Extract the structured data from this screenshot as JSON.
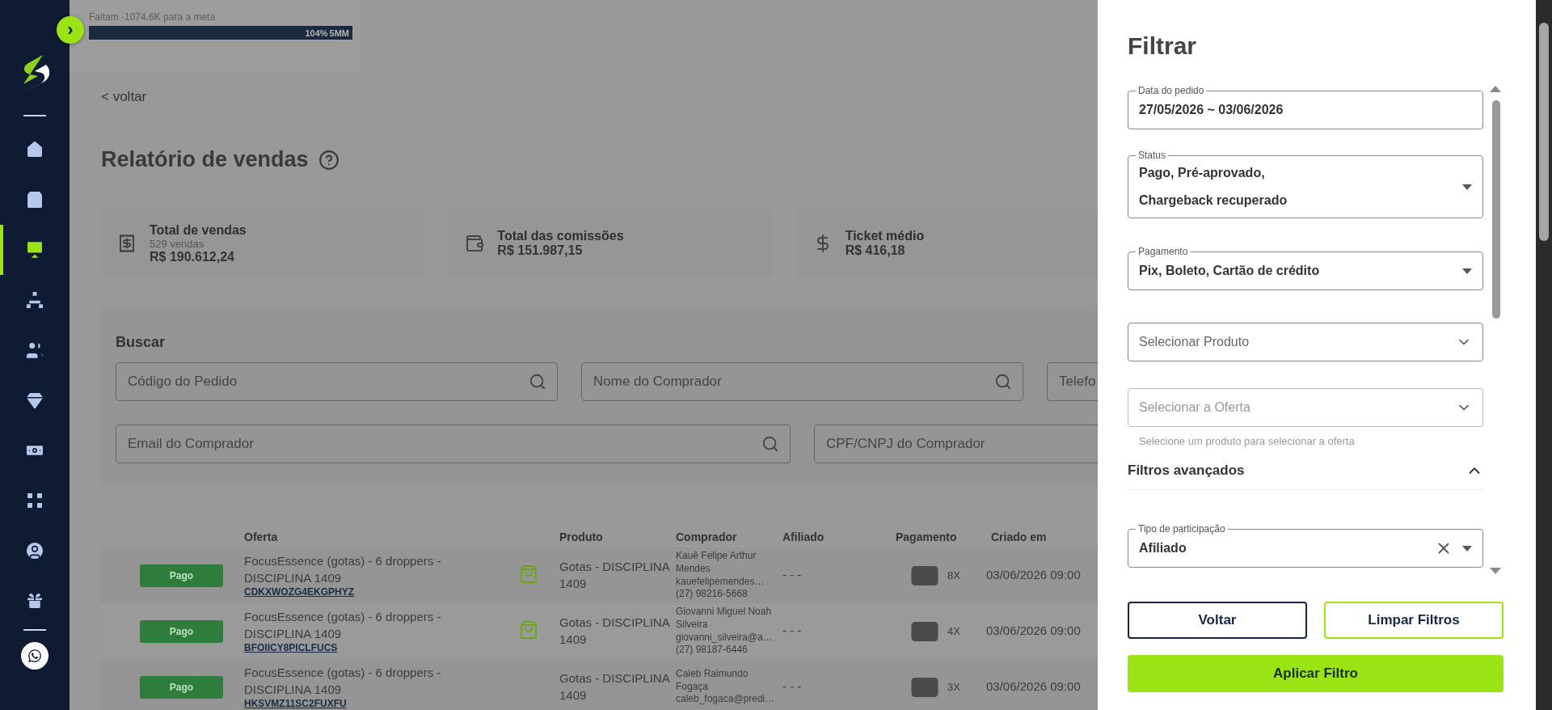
{
  "sidebar": {
    "toggle": "›",
    "items": [
      {
        "selected": false
      },
      {
        "selected": false
      },
      {
        "selected": true
      },
      {
        "selected": false
      },
      {
        "selected": false
      },
      {
        "selected": false
      },
      {
        "selected": false
      },
      {
        "selected": false
      },
      {
        "selected": false
      },
      {
        "selected": false
      }
    ]
  },
  "goal": {
    "caption": "Faltam -1074.6K para a meta",
    "level": 1,
    "percent": "104%",
    "target": "5MM"
  },
  "back_link": "< voltar",
  "title": "Relatório de vendas",
  "summary": [
    {
      "label": "Total de vendas",
      "sub": "529 vendas",
      "value": "R$ 190.612,24"
    },
    {
      "label": "Total das comissões",
      "value": "R$ 151.987,15"
    },
    {
      "label": "Ticket médio",
      "value": "R$ 416,18"
    }
  ],
  "search": {
    "title": "Buscar",
    "rows": [
      [
        {
          "placeholder": "Código do Pedido"
        },
        {
          "placeholder": "Nome do Comprador"
        },
        {
          "placeholder": "Telefo"
        }
      ],
      [
        {
          "placeholder": "Email do Comprador"
        },
        {
          "placeholder": "CPF/CNPJ do Comprador"
        }
      ]
    ]
  },
  "table": {
    "columns": [
      "Oferta",
      "Produto",
      "Comprador",
      "Afiliado",
      "Pagamento",
      "Criado em"
    ],
    "rows": [
      {
        "status": "Pago",
        "offer": "FocusEssence (gotas) - 6 droppers - DISCIPLINA 1409",
        "code": "CDKXWOZG4EKGPHYZ",
        "product_icon": true,
        "product": "Gotas - DISCIPLINA 1409",
        "buyer": [
          "Kauê Felipe Arthur Mendes",
          "kauefelipemendes…",
          "(27) 98216-5668"
        ],
        "affiliate": "- - -",
        "installments": "8X",
        "created": "03/06/2026 09:00"
      },
      {
        "status": "Pago",
        "offer": "FocusEssence (gotas) - 6 droppers - DISCIPLINA 1409",
        "code": "BFOIICY8PICLFUCS",
        "product_icon": true,
        "product": "Gotas - DISCIPLINA 1409",
        "buyer": [
          "Giovanni Miguel Noah Silveira",
          "giovanni_silveira@a…",
          "(27) 98187-6446"
        ],
        "affiliate": "- - -",
        "installments": "4X",
        "created": "03/06/2026 09:00"
      },
      {
        "status": "Pago",
        "offer": "FocusEssence (gotas) - 6 droppers - DISCIPLINA 1409",
        "code": "HKSVMZ11SC2FUXFU",
        "product_icon": false,
        "product": "Gotas - DISCIPLINA 1409",
        "buyer": [
          "Caleb Raimundo Fogaça",
          "caleb_fogaca@predi…"
        ],
        "affiliate": "- - -",
        "installments": "3X",
        "created": "03/06/2026 09:00"
      }
    ]
  },
  "filter": {
    "title": "Filtrar",
    "fields": [
      {
        "kind": "date",
        "label": "Data do pedido",
        "value": "27/05/2026 ~ 03/06/2026"
      },
      {
        "kind": "select",
        "label": "Status",
        "value": "Pago, Pré-aprovado, Chargeback recuperado"
      },
      {
        "kind": "select",
        "label": "Pagamento",
        "value": "Pix, Boleto, Cartão de crédito"
      },
      {
        "kind": "picker",
        "placeholder": "Selecionar Produto"
      },
      {
        "kind": "picker",
        "placeholder": "Selecionar a Oferta",
        "disabled": true,
        "helper": "Selecione um produto para selecionar a oferta"
      }
    ],
    "advanced": {
      "title": "Filtros avançados",
      "expanded": true,
      "fields": [
        {
          "kind": "select",
          "label": "Tipo de participação",
          "value": "Afiliado",
          "clearable": true
        }
      ]
    },
    "buttons": [
      {
        "kind": "outline",
        "label": "Voltar"
      },
      {
        "kind": "outline-accent",
        "label": "Limpar Filtros"
      },
      {
        "kind": "primary",
        "label": "Aplicar Filtro"
      }
    ]
  }
}
